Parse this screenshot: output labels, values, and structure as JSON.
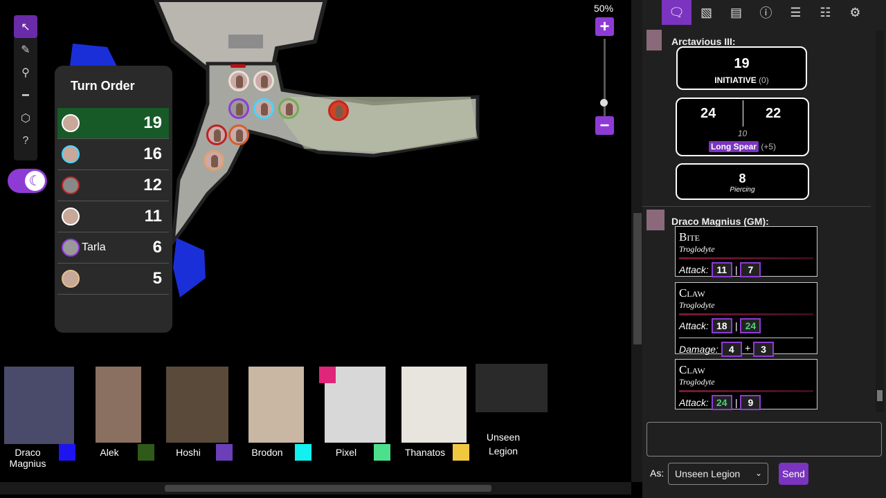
{
  "map": {
    "zoom_label": "50%"
  },
  "toolbar": {
    "tools": [
      "select-icon",
      "brush-icon",
      "zoom-icon",
      "ruler-icon",
      "dice-icon",
      "help-icon"
    ]
  },
  "turn_order": {
    "title": "Turn Order",
    "rows": [
      {
        "name": "",
        "value": "19",
        "active": true
      },
      {
        "name": "",
        "value": "16"
      },
      {
        "name": "",
        "value": "12"
      },
      {
        "name": "",
        "value": "11"
      },
      {
        "name": "Tarla",
        "value": "6"
      },
      {
        "name": "",
        "value": "5"
      }
    ]
  },
  "players": [
    {
      "name": "Draco Magnius",
      "color": "#1e14f0"
    },
    {
      "name": "Alek",
      "color": "#2f5a1a"
    },
    {
      "name": "Hoshi",
      "color": "#6b3fb8"
    },
    {
      "name": "Brodon",
      "color": "#13f0f0"
    },
    {
      "name": "Pixel",
      "color": "#4ce08c"
    },
    {
      "name": "Thanatos",
      "color": "#f0c840"
    },
    {
      "name": "Unseen Legion",
      "color": ""
    }
  ],
  "panel": {
    "tabs": [
      "chat-icon",
      "art-icon",
      "journal-icon",
      "info-icon",
      "decks-icon",
      "list-icon",
      "settings-icon"
    ],
    "msg1": {
      "speaker": "Arctavious III:",
      "initiative_value": "19",
      "initiative_label": "INITIATIVE",
      "initiative_mod": "(0)",
      "roll1": "24",
      "roll2": "22",
      "ac_hint": "10",
      "weapon": "Long Spear",
      "weapon_mod": "(+5)",
      "damage": "8",
      "damage_type": "Piercing"
    },
    "msg2": {
      "speaker": "Draco Magnius (GM):",
      "attacks": [
        {
          "name": "Bite",
          "source": "Troglodyte",
          "label": "Attack:",
          "r1": "11",
          "r2": "7"
        },
        {
          "name": "Claw",
          "source": "Troglodyte",
          "label": "Attack:",
          "r1": "18",
          "r2": "24",
          "damage_label": "Damage:",
          "d1": "4",
          "d2": "3"
        },
        {
          "name": "Claw",
          "source": "Troglodyte",
          "label": "Attack:",
          "r1": "24",
          "r2": "9"
        }
      ]
    },
    "as_label": "As:",
    "as_value": "Unseen Legion",
    "send_label": "Send"
  }
}
